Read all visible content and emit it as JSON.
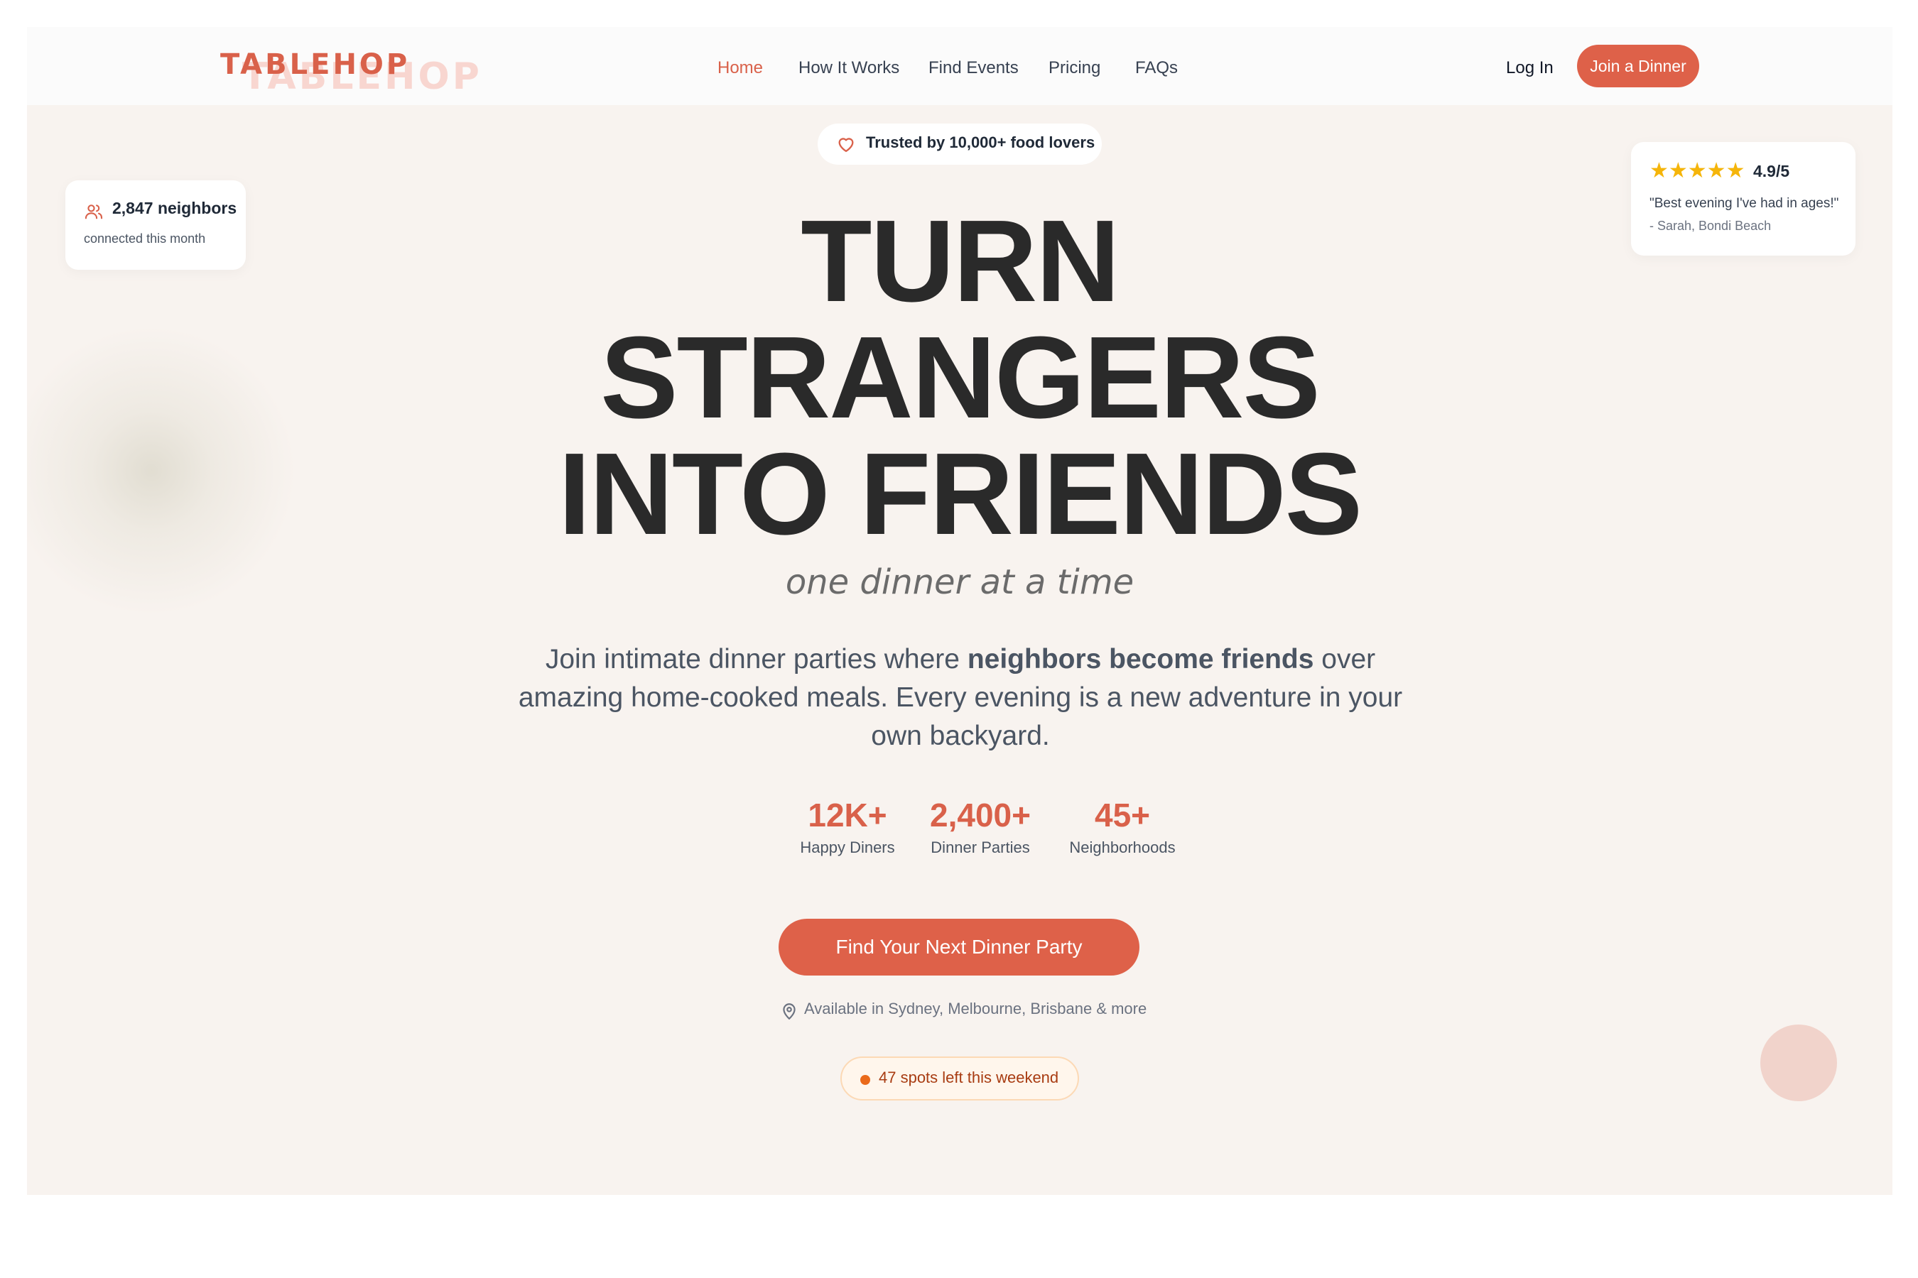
{
  "brand": {
    "logo": "TABLEHOP",
    "logo_ghost": "TABLEHOP",
    "accent": "#de6149"
  },
  "nav": {
    "items": [
      {
        "label": "Home",
        "active": true
      },
      {
        "label": "How It Works"
      },
      {
        "label": "Find Events"
      },
      {
        "label": "Pricing"
      },
      {
        "label": "FAQs"
      }
    ],
    "login": "Log In",
    "join": "Join a Dinner"
  },
  "card_left": {
    "icon": "users-icon",
    "count": "2,847 neighbors",
    "caption": "connected this month"
  },
  "card_right": {
    "stars": "★★★★★",
    "rating": "4.9/5",
    "quote": "\"Best evening I've had in ages!\"",
    "author": "- Sarah, Bondi Beach"
  },
  "hero": {
    "badge": {
      "icon": "heart-icon",
      "text": "Trusted by 10,000+ food lovers"
    },
    "headline": [
      "TURN",
      "STRANGERS",
      "INTO FRIENDS"
    ],
    "subhead": "one dinner at a time",
    "description": {
      "before": "Join intimate dinner parties where ",
      "bold": "neighbors become friends",
      "after": " over amazing home-cooked meals. Every evening is a new adventure in your own backyard."
    },
    "stats": [
      {
        "value": "12K+",
        "label": "Happy Diners"
      },
      {
        "value": "2,400+",
        "label": "Dinner Parties"
      },
      {
        "value": "45+",
        "label": "Neighborhoods"
      }
    ],
    "cta": "Find Your Next Dinner Party",
    "availability": {
      "icon": "map-pin-icon",
      "text": "Available in Sydney, Melbourne, Brisbane & more"
    },
    "spots": "47 spots left this weekend"
  }
}
